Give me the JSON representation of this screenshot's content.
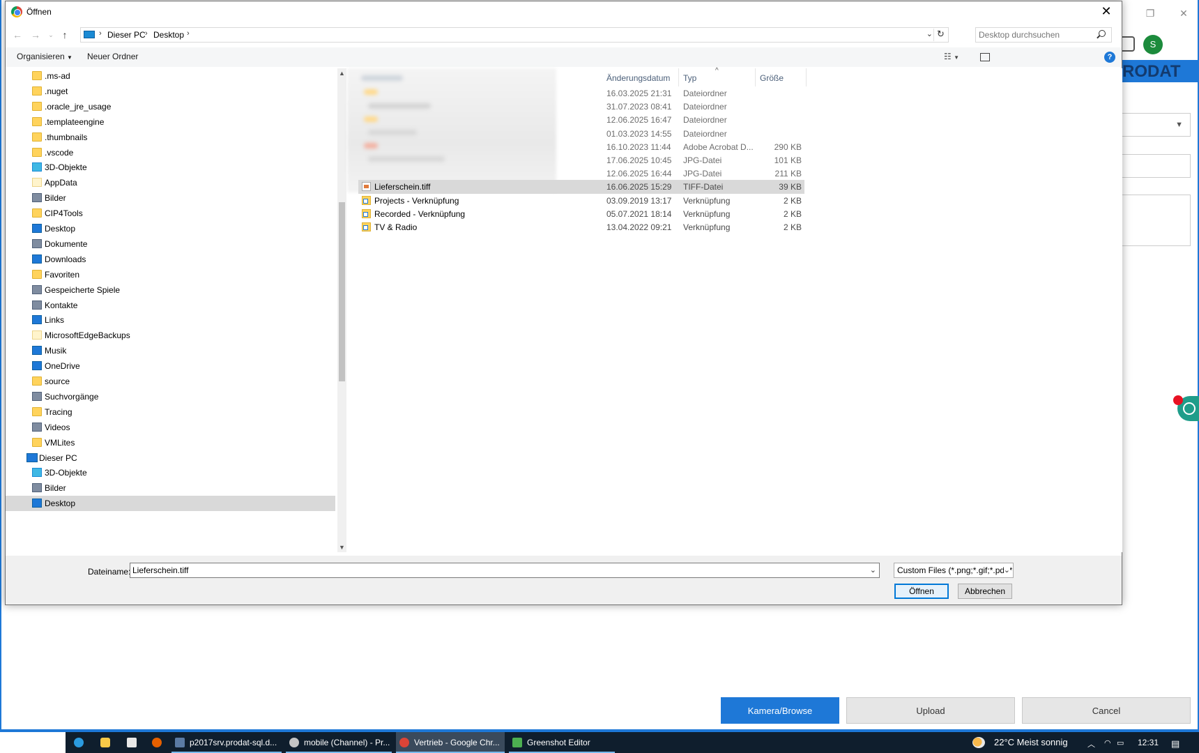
{
  "dialog": {
    "title": "Öffnen",
    "breadcrumb": [
      "Dieser PC",
      "Desktop"
    ],
    "search_placeholder": "Desktop durchsuchen",
    "toolbar": {
      "organize": "Organisieren",
      "new_folder": "Neuer Ordner"
    },
    "nav_items": [
      {
        "label": ".ms-ad",
        "icon": "folder-icon"
      },
      {
        "label": ".nuget",
        "icon": "folder-icon"
      },
      {
        "label": ".oracle_jre_usage",
        "icon": "folder-icon"
      },
      {
        "label": ".templateengine",
        "icon": "folder-icon"
      },
      {
        "label": ".thumbnails",
        "icon": "folder-icon"
      },
      {
        "label": ".vscode",
        "icon": "folder-icon"
      },
      {
        "label": "3D-Objekte",
        "icon": "cube-icon"
      },
      {
        "label": "AppData",
        "icon": "folder-icon"
      },
      {
        "label": "Bilder",
        "icon": "pictures-icon"
      },
      {
        "label": "CIP4Tools",
        "icon": "folder-icon"
      },
      {
        "label": "Desktop",
        "icon": "desktop-icon"
      },
      {
        "label": "Dokumente",
        "icon": "documents-icon"
      },
      {
        "label": "Downloads",
        "icon": "download-icon"
      },
      {
        "label": "Favoriten",
        "icon": "star-icon"
      },
      {
        "label": "Gespeicherte Spiele",
        "icon": "games-icon"
      },
      {
        "label": "Kontakte",
        "icon": "contacts-icon"
      },
      {
        "label": "Links",
        "icon": "link-icon"
      },
      {
        "label": "MicrosoftEdgeBackups",
        "icon": "folder-icon"
      },
      {
        "label": "Musik",
        "icon": "music-icon"
      },
      {
        "label": "OneDrive",
        "icon": "cloud-icon"
      },
      {
        "label": "source",
        "icon": "folder-icon"
      },
      {
        "label": "Suchvorgänge",
        "icon": "search-icon"
      },
      {
        "label": "Tracing",
        "icon": "folder-icon"
      },
      {
        "label": "Videos",
        "icon": "video-icon"
      },
      {
        "label": "VMLites",
        "icon": "folder-icon"
      },
      {
        "label": "Dieser PC",
        "icon": "pc-icon"
      },
      {
        "label": "3D-Objekte",
        "icon": "cube-icon"
      },
      {
        "label": "Bilder",
        "icon": "pictures-icon"
      },
      {
        "label": "Desktop",
        "icon": "desktop-icon"
      }
    ],
    "columns": {
      "date": "Änderungsdatum",
      "type": "Typ",
      "size": "Größe"
    },
    "files": [
      {
        "name": "",
        "date": "16.03.2025 21:31",
        "type": "Dateiordner",
        "size": ""
      },
      {
        "name": "",
        "date": "31.07.2023 08:41",
        "type": "Dateiordner",
        "size": ""
      },
      {
        "name": "",
        "date": "12.06.2025 16:47",
        "type": "Dateiordner",
        "size": ""
      },
      {
        "name": "",
        "date": "01.03.2023 14:55",
        "type": "Dateiordner",
        "size": ""
      },
      {
        "name": "",
        "date": "16.10.2023 11:44",
        "type": "Adobe Acrobat D...",
        "size": "290 KB"
      },
      {
        "name": "",
        "date": "17.06.2025 10:45",
        "type": "JPG-Datei",
        "size": "101 KB"
      },
      {
        "name": "",
        "date": "12.06.2025 16:44",
        "type": "JPG-Datei",
        "size": "211 KB"
      },
      {
        "name": "Lieferschein.tiff",
        "date": "16.06.2025 15:29",
        "type": "TIFF-Datei",
        "size": "39 KB"
      },
      {
        "name": "Projects - Verknüpfung",
        "date": "03.09.2019 13:17",
        "type": "Verknüpfung",
        "size": "2 KB"
      },
      {
        "name": "Recorded - Verknüpfung",
        "date": "05.07.2021 18:14",
        "type": "Verknüpfung",
        "size": "2 KB"
      },
      {
        "name": "TV & Radio",
        "date": "13.04.2022 09:21",
        "type": "Verknüpfung",
        "size": "2 KB"
      }
    ],
    "filename_label": "Dateiname:",
    "filename_value": "Lieferschein.tiff",
    "filetype_value": "Custom Files (*.png;*.gif;*.pdf;*",
    "open_label": "Öffnen",
    "cancel_label": "Abbrechen"
  },
  "background_app": {
    "brand": "RODAT",
    "profile_initial": "S",
    "buttons": {
      "camera": "Kamera/Browse",
      "upload": "Upload",
      "cancel": "Cancel"
    }
  },
  "taskbar": {
    "tasks": [
      {
        "label": "p2017srv.prodat-sql.d..."
      },
      {
        "label": "mobile (Channel) - Pr..."
      },
      {
        "label": "Vertrieb - Google Chr..."
      },
      {
        "label": "Greenshot Editor"
      }
    ],
    "weather": "22°C  Meist sonnig",
    "clock": "12:31"
  },
  "colors": {
    "accent": "#1e78d7",
    "taskbar": "#0f1e2d",
    "selection": "#d9d9d9"
  }
}
